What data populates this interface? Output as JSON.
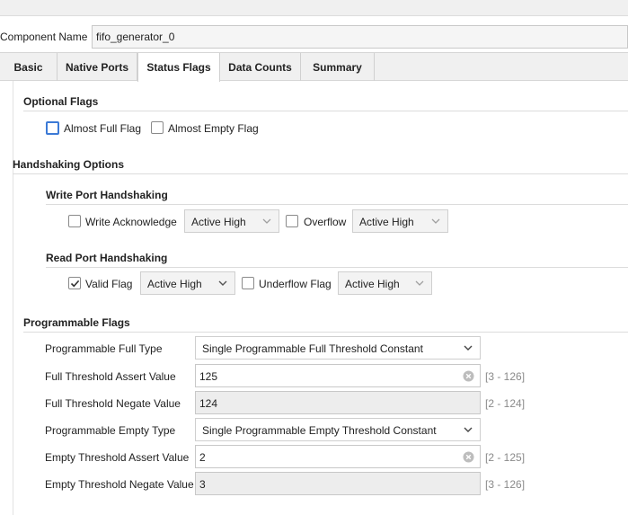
{
  "component": {
    "label": "Component Name",
    "value": "fifo_generator_0"
  },
  "tabs": [
    {
      "label": "Basic"
    },
    {
      "label": "Native Ports"
    },
    {
      "label": "Status Flags"
    },
    {
      "label": "Data Counts"
    },
    {
      "label": "Summary"
    }
  ],
  "optional_flags": {
    "title": "Optional Flags",
    "almost_full": {
      "label": "Almost Full Flag",
      "checked": false
    },
    "almost_empty": {
      "label": "Almost Empty Flag",
      "checked": false
    }
  },
  "handshaking": {
    "title": "Handshaking Options",
    "write": {
      "title": "Write Port Handshaking",
      "write_ack": {
        "label": "Write Acknowledge",
        "checked": false,
        "select": "Active High"
      },
      "overflow": {
        "label": "Overflow",
        "checked": false,
        "select": "Active High"
      }
    },
    "read": {
      "title": "Read Port Handshaking",
      "valid": {
        "label": "Valid Flag",
        "checked": true,
        "select": "Active High"
      },
      "underflow": {
        "label": "Underflow Flag",
        "checked": false,
        "select": "Active High"
      }
    }
  },
  "programmable": {
    "title": "Programmable Flags",
    "full_type": {
      "label": "Programmable Full Type",
      "value": "Single Programmable Full Threshold Constant"
    },
    "full_assert": {
      "label": "Full Threshold Assert Value",
      "value": "125",
      "range": "[3 - 126]"
    },
    "full_negate": {
      "label": "Full Threshold Negate Value",
      "value": "124",
      "range": "[2 - 124]"
    },
    "empty_type": {
      "label": "Programmable Empty Type",
      "value": "Single Programmable Empty Threshold Constant"
    },
    "empty_assert": {
      "label": "Empty Threshold Assert Value",
      "value": "2",
      "range": "[2 - 125]"
    },
    "empty_negate": {
      "label": "Empty Threshold Negate Value",
      "value": "3",
      "range": "[3 - 126]"
    }
  },
  "colors": {
    "accent": "#3c7ad6",
    "tabbar": "#f0f0f0",
    "readonly": "#ededed"
  },
  "icons": {
    "dropdown": "chevron-down-icon",
    "clear": "clear-input-icon",
    "check": "checkmark-icon"
  }
}
